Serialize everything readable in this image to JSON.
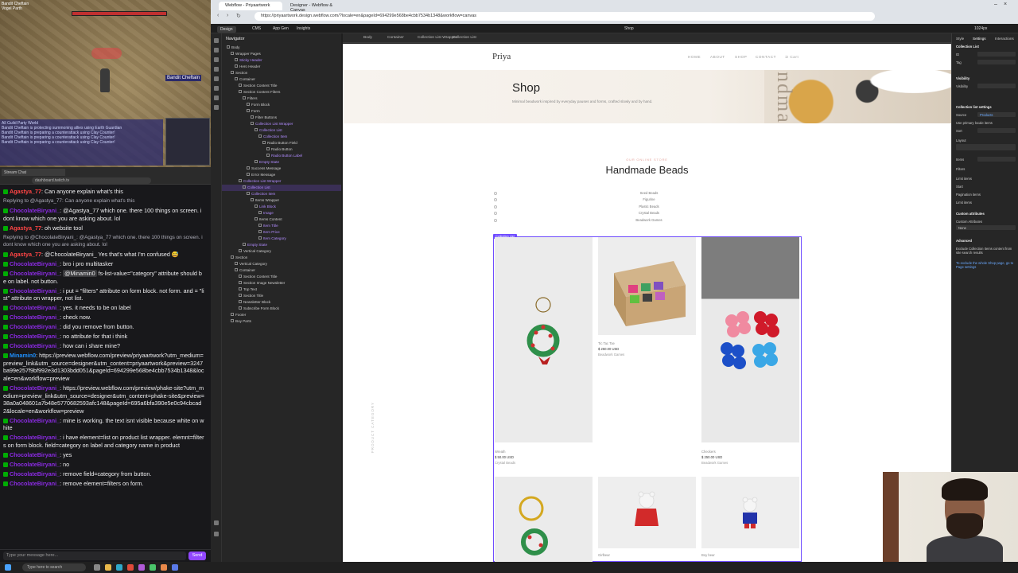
{
  "game": {
    "top_labels": [
      "Bandit Cheftain",
      "Vogel Parth"
    ],
    "nametag": "Bandit Cheftain",
    "chat_lines": [
      "Bandit Cheftain is protecting summoning allies using Earth Guardian",
      "Bandit Cheftain is preparing a counterattack using Clay Counter!",
      "Bandit Cheftain is preparing a counterattack using Clay Counter!",
      "Bandit Cheftain is preparing a counterattack using Clay Counter!"
    ],
    "chat_tabs": "All  Guild  Party  World"
  },
  "chat_browser": {
    "tab_label": "Stream Chat",
    "url": "dashboard.twitch.tv"
  },
  "chat": {
    "messages": [
      {
        "user": "Agastya_77",
        "color": "u1",
        "text": ": Can anyone explain what's this"
      },
      {
        "reply": "Replying to @Agastya_77: Can anyone explain what's this"
      },
      {
        "user": "ChocolateBiryani_",
        "color": "u2",
        "text": ": @Agastya_77 which one. there 100 things on screen. i dont know which one you are asking about. lol"
      },
      {
        "user": "Agastya_77",
        "color": "u1",
        "text": ": oh website tool"
      },
      {
        "reply": "Replying to @ChocolateBiryani_: @Agastya_77 which one. there 100 things on screen. i dont know which one you are asking about. lol"
      },
      {
        "user": "Agastya_77",
        "color": "u1",
        "text": ": @ChocolateBiryani_ Yes that's what I'm confused 😅"
      },
      {
        "user": "ChocolateBiryani_",
        "color": "u2",
        "text": ": bro i pro multitasker"
      },
      {
        "user": "ChocolateBiryani_",
        "color": "u2",
        "highlight": "@Minamin0",
        "text": " fs-list-value=\"category\" attribute should be on label. not button."
      },
      {
        "user": "ChocolateBiryani_",
        "color": "u2",
        "text": ": i put = \"filters\" attribute on form block. not form. and = \"list\" attribute on wrapper, not list."
      },
      {
        "user": "ChocolateBiryani_",
        "color": "u2",
        "text": ": yes. it needs to be on label"
      },
      {
        "user": "ChocolateBiryani_",
        "color": "u2",
        "text": ": check now."
      },
      {
        "user": "ChocolateBiryani_",
        "color": "u2",
        "text": ": did you remove from button."
      },
      {
        "user": "ChocolateBiryani_",
        "color": "u2",
        "text": ": no attribute for that i think"
      },
      {
        "user": "ChocolateBiryani_",
        "color": "u2",
        "text": ": how can i share mine?"
      },
      {
        "user": "Minamin0",
        "color": "u3",
        "text": ": https://preview.webflow.com/preview/priyaartwork?utm_medium=preview_link&utm_source=designer&utm_content=priyaartwork&preview=3247ba99e257f9bf992e3d1303bdd051&pageId=694299e568be4cbb7534b1348&locale=en&workflow=preview"
      },
      {
        "user": "ChocolateBiryani_",
        "color": "u2",
        "text": ": https://preview.webflow.com/preview/phake-site?utm_medium=preview_link&utm_source=designer&utm_content=phake-site&preview=38a0a048601a7b48e5770682593afc148&pageId=695a6bfa390e5e0c94cbcad2&locale=en&workflow=preview"
      },
      {
        "user": "ChocolateBiryani_",
        "color": "u2",
        "text": ": mine is working. the text isnt visible because white on white"
      },
      {
        "user": "ChocolateBiryani_",
        "color": "u2",
        "text": ": i have element=list on product list wrapper. elemnt=filters on form block. field=category on label and category name in product"
      },
      {
        "user": "ChocolateBiryani_",
        "color": "u2",
        "text": ": yes"
      },
      {
        "user": "ChocolateBiryani_",
        "color": "u2",
        "text": ": no"
      },
      {
        "user": "ChocolateBiryani_",
        "color": "u2",
        "text": ": remove field=category from button."
      },
      {
        "user": "ChocolateBiryani_",
        "color": "u2",
        "text": ": remove element=filters on form."
      }
    ],
    "input_placeholder": "Type your message here...",
    "send_label": "Send",
    "user_label": "ChocolateBiryani_"
  },
  "taskbar": {
    "search_placeholder": "Type here to search"
  },
  "browser": {
    "tabs": [
      "Webflow - Priyaartwork",
      "Designer - Webflow & Canvas"
    ],
    "url": "https://priyaartwork.design.webflow.com/?locale=en&pageId=694299e568be4cbb7534b1348&workflow=canvas"
  },
  "wf_top": {
    "items": [
      "Design",
      "CMS",
      "App Gen",
      "Insights"
    ],
    "page": "Shop",
    "zoom": "1024px"
  },
  "navigator": {
    "title": "Navigator",
    "nodes": [
      {
        "label": "Body",
        "indent": 0
      },
      {
        "label": "Wrapper Pages",
        "indent": 1
      },
      {
        "label": "Sticky Header",
        "indent": 2,
        "purple": true
      },
      {
        "label": "Hero Header",
        "indent": 2
      },
      {
        "label": "Section",
        "indent": 1
      },
      {
        "label": "Container",
        "indent": 2
      },
      {
        "label": "Section Content Title",
        "indent": 3
      },
      {
        "label": "Section Content Filters",
        "indent": 3
      },
      {
        "label": "Filters",
        "indent": 4
      },
      {
        "label": "Form Block",
        "indent": 5
      },
      {
        "label": "Form",
        "indent": 5
      },
      {
        "label": "Filter Buttons",
        "indent": 6
      },
      {
        "label": "Collection List Wrapper",
        "indent": 6,
        "purple": true
      },
      {
        "label": "Collection List",
        "indent": 7,
        "purple": true
      },
      {
        "label": "Collection Item",
        "indent": 8,
        "purple": true
      },
      {
        "label": "Radio Button Field",
        "indent": 9
      },
      {
        "label": "Radio Button",
        "indent": 10
      },
      {
        "label": "Radio Button Label",
        "indent": 10,
        "purple": true
      },
      {
        "label": "Empty State",
        "indent": 7,
        "purple": true
      },
      {
        "label": "Success Message",
        "indent": 5
      },
      {
        "label": "Error Message",
        "indent": 5
      },
      {
        "label": "Collection List Wrapper",
        "indent": 3,
        "purple": true
      },
      {
        "label": "Collection List",
        "indent": 4,
        "purple": true,
        "sel": true
      },
      {
        "label": "Collection Item",
        "indent": 5,
        "purple": true
      },
      {
        "label": "Items Wrapper",
        "indent": 6
      },
      {
        "label": "Link Block",
        "indent": 7,
        "purple": true
      },
      {
        "label": "Image",
        "indent": 8,
        "purple": true
      },
      {
        "label": "Items Content",
        "indent": 7
      },
      {
        "label": "Item Title",
        "indent": 8,
        "purple": true
      },
      {
        "label": "Item Price",
        "indent": 8,
        "purple": true
      },
      {
        "label": "Item Category",
        "indent": 8,
        "purple": true
      },
      {
        "label": "Empty State",
        "indent": 4,
        "purple": true
      },
      {
        "label": "Vertical Category",
        "indent": 3
      },
      {
        "label": "Section",
        "indent": 1
      },
      {
        "label": "Vertical Category",
        "indent": 2
      },
      {
        "label": "Container",
        "indent": 2
      },
      {
        "label": "Section Content Title",
        "indent": 3
      },
      {
        "label": "Section Image Newsletter",
        "indent": 3
      },
      {
        "label": "Top Text",
        "indent": 3
      },
      {
        "label": "Section Title",
        "indent": 3
      },
      {
        "label": "Newsletter Block",
        "indent": 3
      },
      {
        "label": "Subscribe Form Block",
        "indent": 3
      },
      {
        "label": "Footer",
        "indent": 1
      },
      {
        "label": "Buy Parts",
        "indent": 1
      }
    ]
  },
  "crumb": {
    "items": [
      "Body",
      "Container",
      "Collection List Wrapper",
      "Collection List"
    ]
  },
  "site": {
    "logo": "Priya",
    "nav": [
      "HOME",
      "ABOUT",
      "SHOP",
      "CONTACT",
      "Cart"
    ],
    "hero_title": "Shop",
    "hero_sub": "Minimal beadwork inspired by everyday pauses and forms, crafted slowly and by hand.",
    "hero_deco": "ndma",
    "eyebrow": "OUR ONLINE STORE",
    "section_title": "Handmade Beads",
    "filters": [
      "Seed Beads",
      "Figurine",
      "Plastic Beads",
      "Crystal Beads",
      "Beadwork Games"
    ],
    "cl_tag": "Collection List",
    "vertical_label": "PRODUCT CATEGORY",
    "products": [
      {
        "name": "Wreath",
        "price": "$ 50.00 USD",
        "category": "Crystal Beads"
      },
      {
        "name": "Tic Tac Toe",
        "price": "$ 250.00 USD",
        "category": "Beadwork Games"
      },
      {
        "name": "Checkers",
        "price": "$ 250.00 USD",
        "category": "Beadwork Games"
      },
      {
        "name": "",
        "price": "",
        "category": ""
      },
      {
        "name": "Girlbear",
        "price": "",
        "category": ""
      },
      {
        "name": "Boy bear",
        "price": "",
        "category": ""
      }
    ]
  },
  "settings": {
    "tabs": [
      "Style",
      "Settings",
      "Interactions"
    ],
    "labels": [
      "Collection List",
      "ID",
      "Tag",
      "Visibility",
      "Visibility",
      "Collection list settings",
      "Source",
      "Use primary locale items",
      "Sort",
      "Layout",
      "Items",
      "Filters",
      "Limit items",
      "Start",
      "Pagination items",
      "Limit items",
      "Custom attributes",
      "Custom Attributes",
      "Advanced",
      "Exclude Collection Items content from site search results",
      "To exclude the whole Shop page, go to Page settings"
    ],
    "source_value": "Products",
    "attr_value": "None"
  }
}
